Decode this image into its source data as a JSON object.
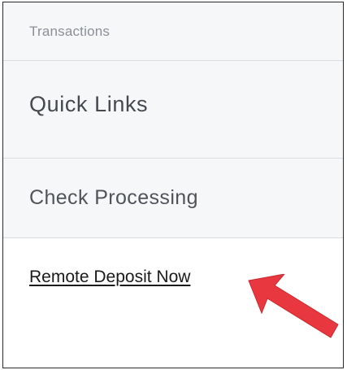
{
  "nav": {
    "transactions_label": "Transactions",
    "quick_links_label": "Quick Links",
    "check_processing_label": "Check Processing",
    "remote_deposit_link": "Remote Deposit Now"
  },
  "annotation": {
    "arrow_icon": "red-arrow-icon",
    "arrow_color": "#e8373e"
  }
}
